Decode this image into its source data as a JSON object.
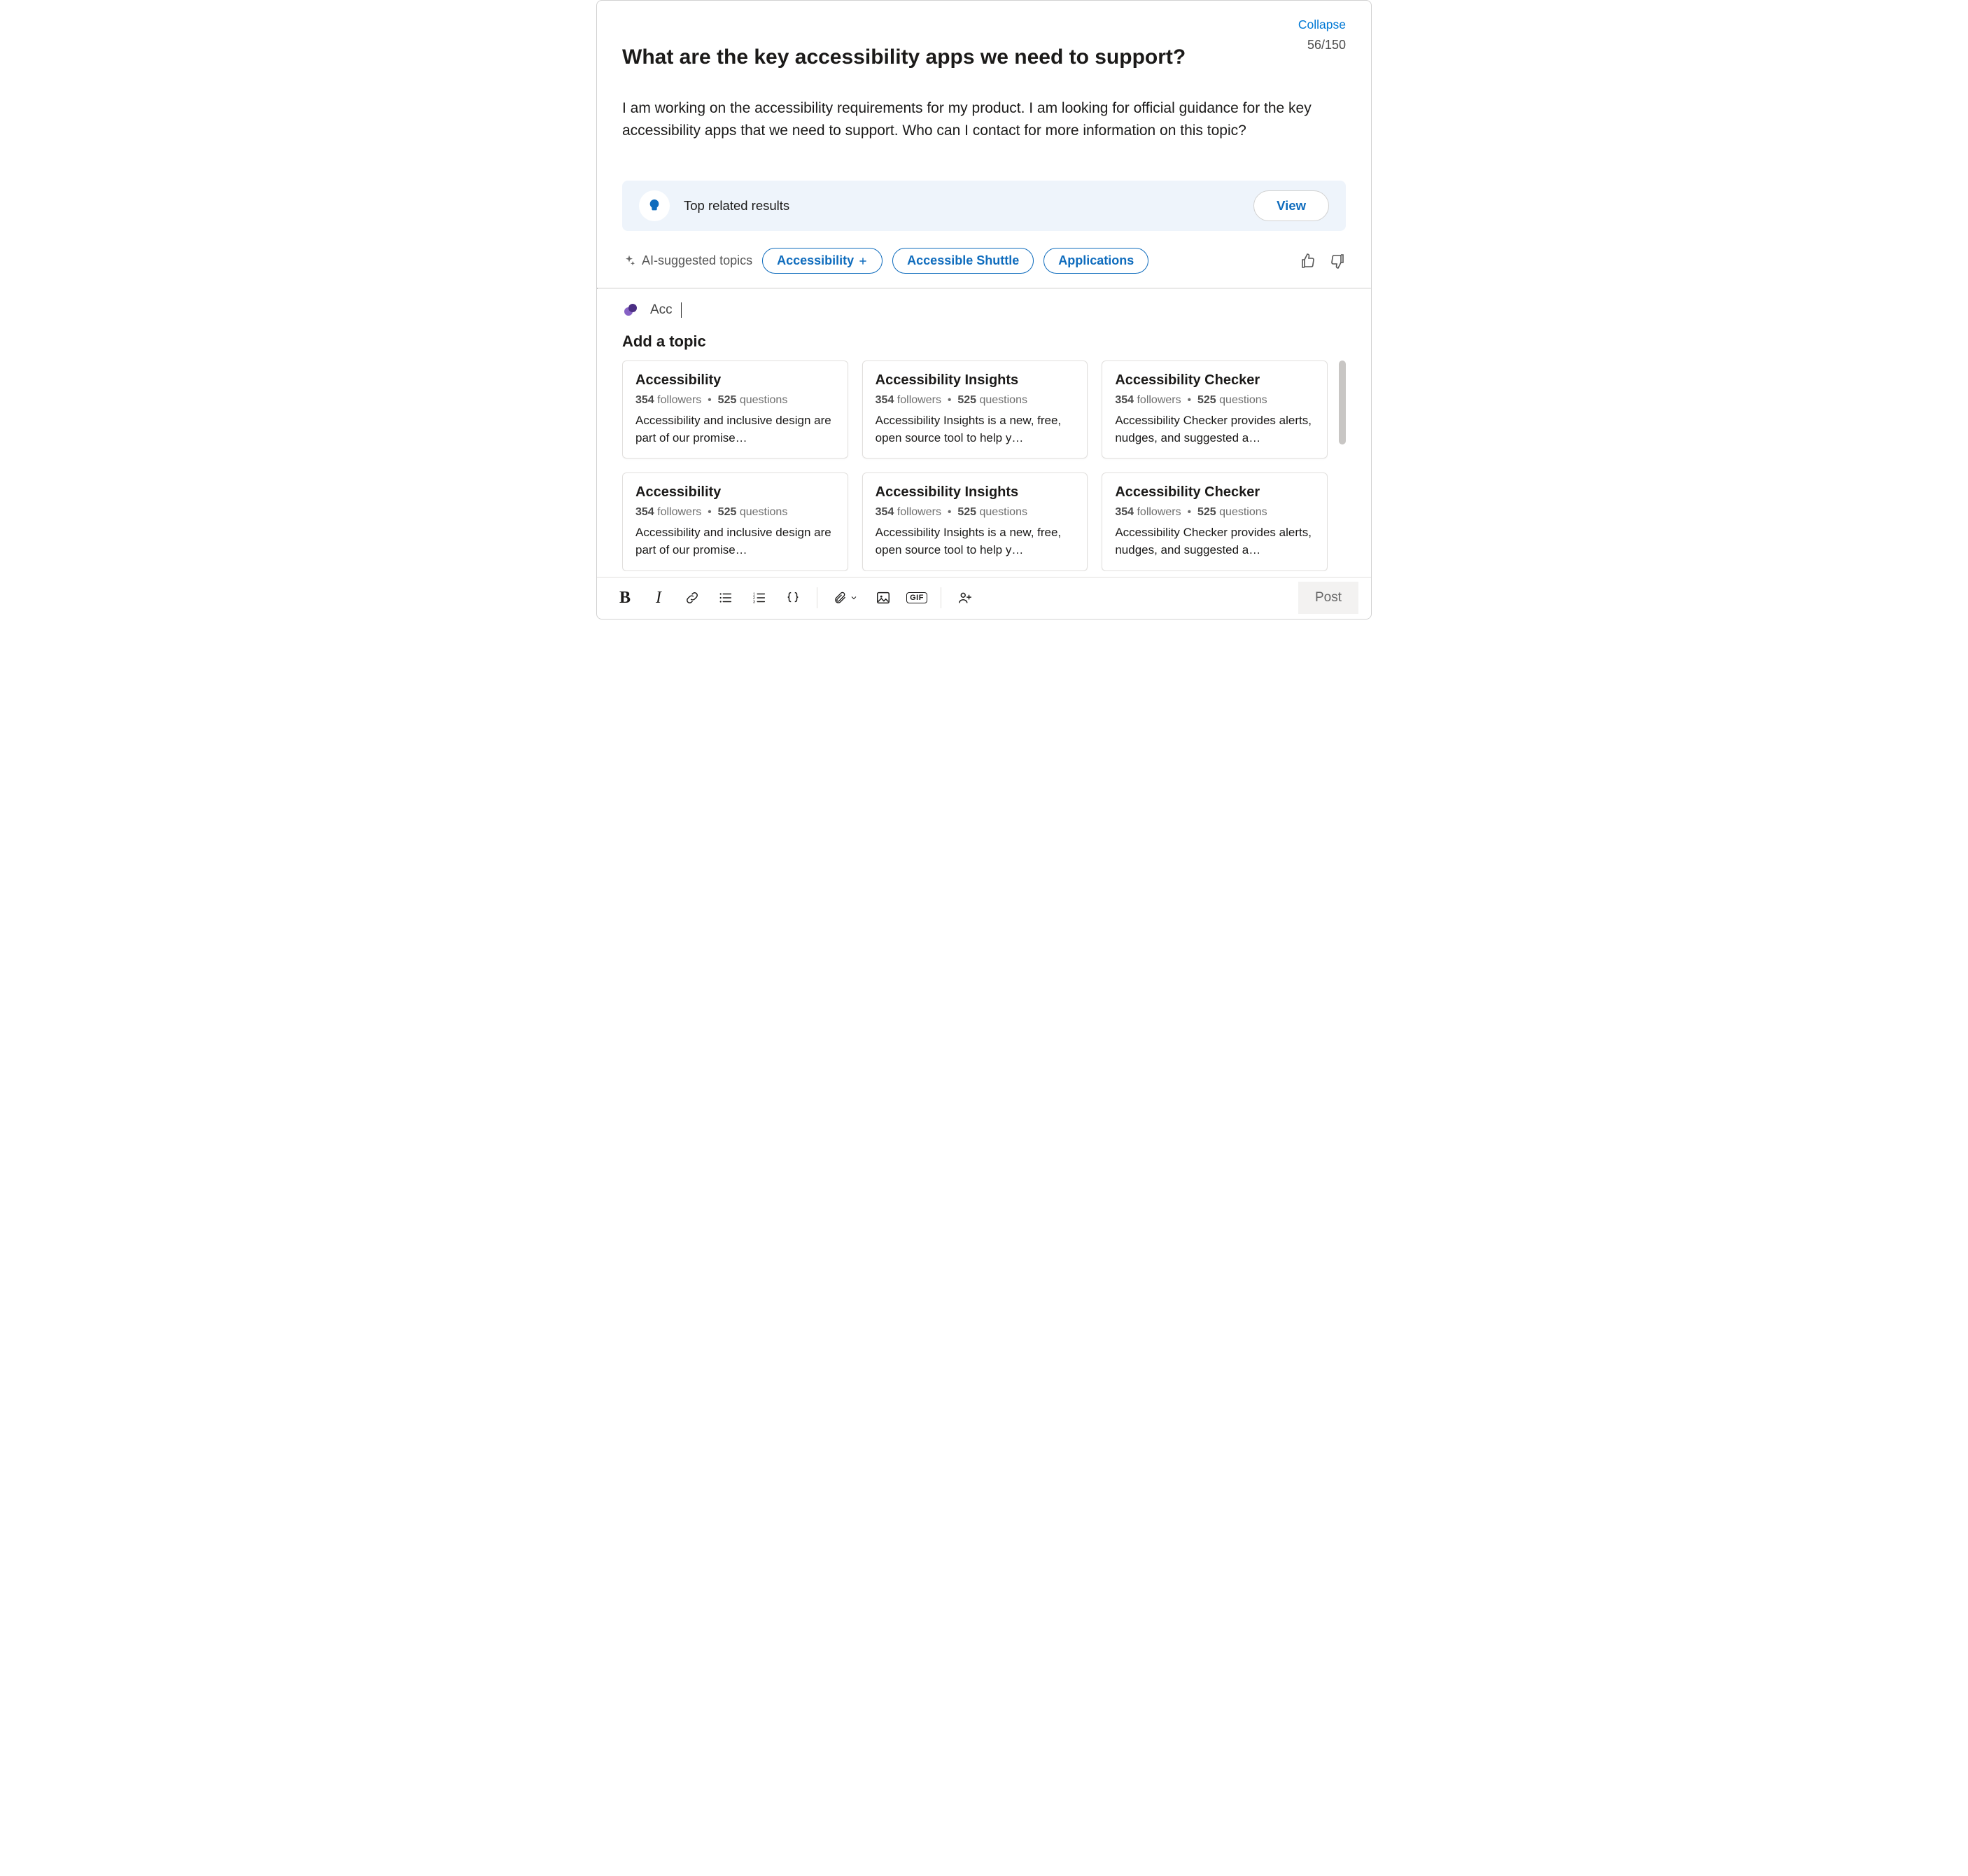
{
  "header": {
    "collapse_label": "Collapse",
    "counter": "56/150",
    "title": "What are the key accessibility apps we need to support?",
    "body": "I am working on the accessibility requirements for my product. I am looking for official guidance for the key accessibility apps that we need to support. Who can I contact for more information on this topic?"
  },
  "related": {
    "label": "Top related results",
    "view_label": "View"
  },
  "ai": {
    "label": "AI-suggested topics",
    "chips": [
      "Accessibility",
      "Accessible Shuttle",
      "Applications"
    ]
  },
  "topic_picker": {
    "search_value": "Acc",
    "heading": "Add a topic",
    "followers_word": "followers",
    "questions_word": "questions",
    "sep": "•",
    "cards": [
      {
        "title": "Accessibility",
        "followers": "354",
        "questions": "525",
        "desc": "Accessibility and inclusive design are part of our promise…"
      },
      {
        "title": "Accessibility Insights",
        "followers": "354",
        "questions": "525",
        "desc": "Accessibility Insights is a new, free, open source tool to help y…"
      },
      {
        "title": "Accessibility Checker",
        "followers": "354",
        "questions": "525",
        "desc": "Accessibility Checker provides alerts, nudges, and suggested a…"
      },
      {
        "title": "Accessibility",
        "followers": "354",
        "questions": "525",
        "desc": "Accessibility and inclusive design are part of our promise…"
      },
      {
        "title": "Accessibility Insights",
        "followers": "354",
        "questions": "525",
        "desc": "Accessibility Insights is a new, free, open source tool to help y…"
      },
      {
        "title": "Accessibility Checker",
        "followers": "354",
        "questions": "525",
        "desc": "Accessibility Checker provides alerts, nudges, and suggested a…"
      }
    ]
  },
  "toolbar": {
    "post_label": "Post",
    "gif_label": "GIF"
  }
}
